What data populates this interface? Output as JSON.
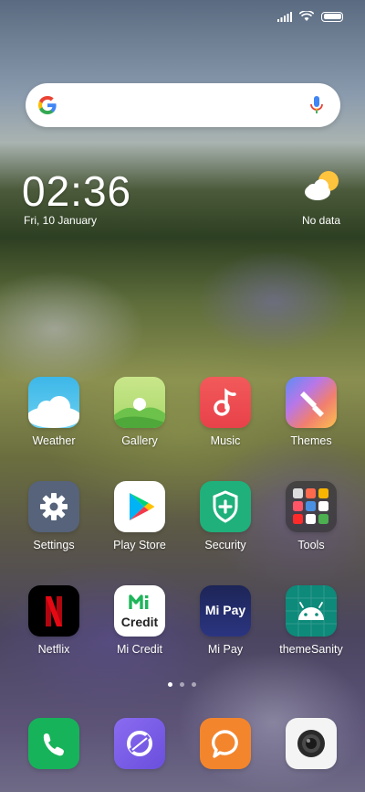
{
  "status": {
    "icons": [
      "signal-icon",
      "wifi-icon",
      "battery-icon"
    ]
  },
  "search": {
    "icons": [
      "google-g-icon",
      "mic-icon"
    ]
  },
  "clock": {
    "time": "02:36",
    "date": "Fri, 10 January"
  },
  "weather_widget": {
    "status": "No data",
    "icon": "partly-cloudy-icon"
  },
  "apps": [
    {
      "label": "Weather",
      "icon": "weather-icon"
    },
    {
      "label": "Gallery",
      "icon": "gallery-icon"
    },
    {
      "label": "Music",
      "icon": "music-icon"
    },
    {
      "label": "Themes",
      "icon": "themes-icon"
    },
    {
      "label": "Settings",
      "icon": "settings-icon"
    },
    {
      "label": "Play Store",
      "icon": "play-store-icon"
    },
    {
      "label": "Security",
      "icon": "security-icon"
    },
    {
      "label": "Tools",
      "icon": "tools-folder-icon"
    },
    {
      "label": "Netflix",
      "icon": "netflix-icon"
    },
    {
      "label": "Mi Credit",
      "icon": "mi-credit-icon",
      "icon_text": "Credit"
    },
    {
      "label": "Mi Pay",
      "icon": "mi-pay-icon",
      "icon_text": "Mi Pay"
    },
    {
      "label": "themeSanity",
      "icon": "android-icon"
    }
  ],
  "dock": [
    {
      "icon": "phone-icon"
    },
    {
      "icon": "browser-icon"
    },
    {
      "icon": "messaging-icon"
    },
    {
      "icon": "camera-icon"
    }
  ],
  "pages": {
    "count": 3,
    "active": 1
  }
}
